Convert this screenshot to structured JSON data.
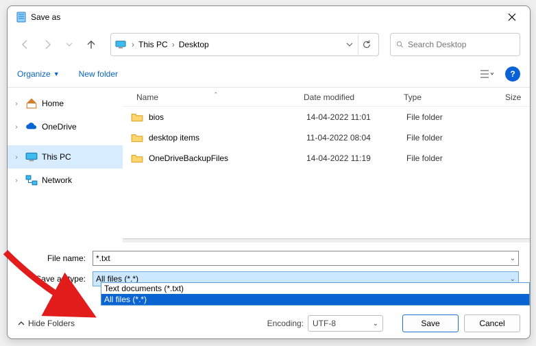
{
  "titlebar": {
    "title": "Save as"
  },
  "breadcrumb": {
    "items": [
      "This PC",
      "Desktop"
    ]
  },
  "search": {
    "placeholder": "Search Desktop"
  },
  "toolbar": {
    "organize": "Organize",
    "new_folder": "New folder"
  },
  "help": {
    "symbol": "?"
  },
  "tree": [
    {
      "label": "Home",
      "icon": "house",
      "selected": false
    },
    {
      "label": "OneDrive",
      "icon": "cloud",
      "selected": false
    },
    {
      "label": "This PC",
      "icon": "monitor",
      "selected": true
    },
    {
      "label": "Network",
      "icon": "network",
      "selected": false
    }
  ],
  "columns": {
    "name": "Name",
    "date": "Date modified",
    "type": "Type",
    "size": "Size"
  },
  "files": [
    {
      "name": "bios",
      "date": "14-04-2022 11:01",
      "type": "File folder"
    },
    {
      "name": "desktop items",
      "date": "11-04-2022 08:04",
      "type": "File folder"
    },
    {
      "name": "OneDriveBackupFiles",
      "date": "14-04-2022 11:19",
      "type": "File folder"
    }
  ],
  "fields": {
    "filename_label": "File name:",
    "filename_value": "*.txt",
    "savetype_label": "Save as type:",
    "savetype_value": "All files  (*.*)"
  },
  "dropdown": {
    "opt0": "Text documents (*.txt)",
    "opt1": "All files  (*.*)"
  },
  "bottom": {
    "hide": "Hide Folders",
    "encoding_label": "Encoding:",
    "encoding_value": "UTF-8",
    "save": "Save",
    "cancel": "Cancel"
  }
}
